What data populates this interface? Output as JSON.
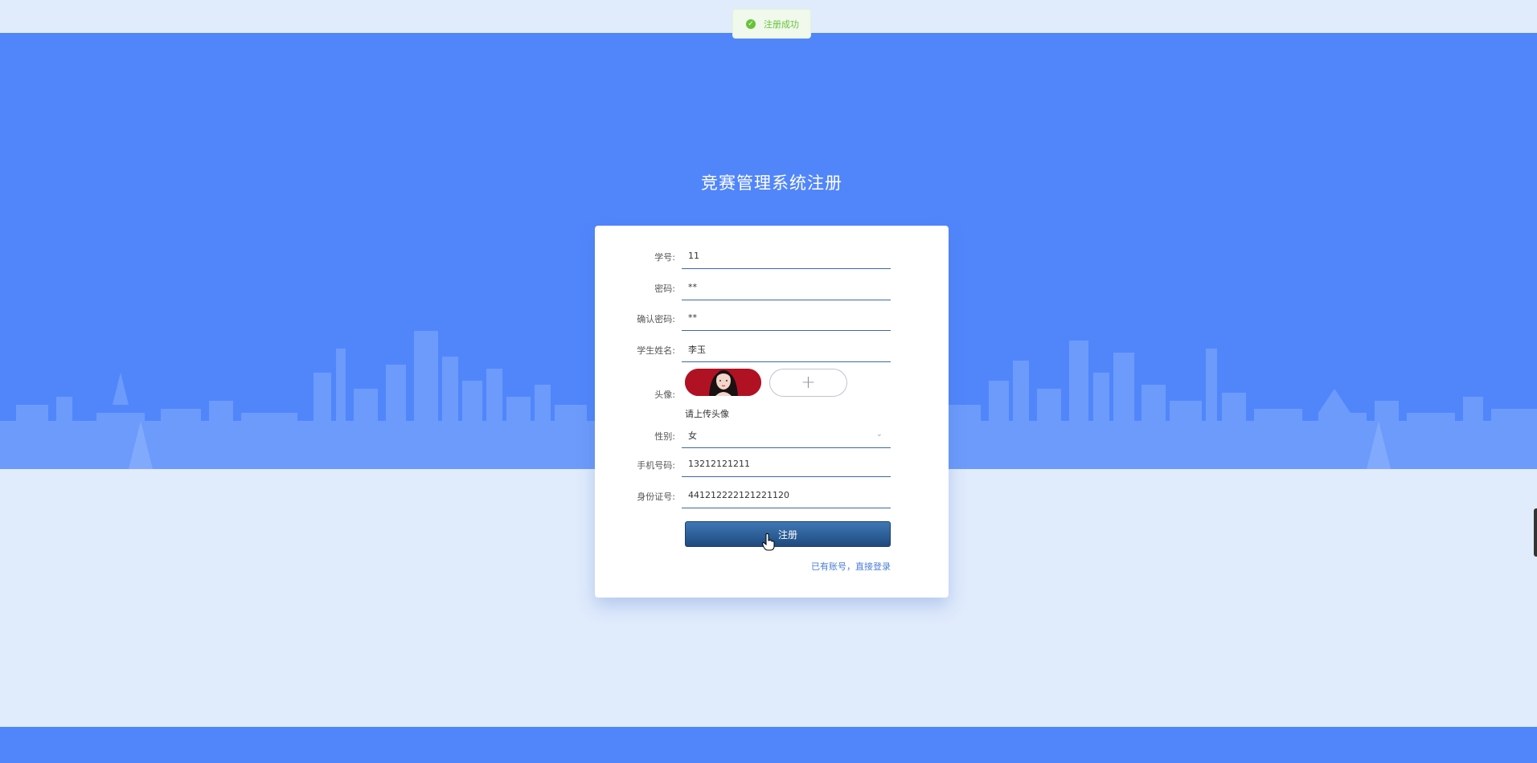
{
  "toast": {
    "icon": "check-circle-icon",
    "text": "注册成功",
    "color": "#67c23a"
  },
  "page": {
    "title": "竞赛管理系统注册"
  },
  "form": {
    "student_id": {
      "label": "学号:",
      "value": "11"
    },
    "password": {
      "label": "密码:",
      "value": "**"
    },
    "confirm_password": {
      "label": "确认密码:",
      "value": "**"
    },
    "student_name": {
      "label": "学生姓名:",
      "value": "李玉"
    },
    "avatar": {
      "label": "头像:",
      "upload_icon": "plus-icon",
      "tip": "请上传头像"
    },
    "gender": {
      "label": "性别:",
      "value": "女",
      "icon": "chevron-down-icon"
    },
    "phone": {
      "label": "手机号码:",
      "value": "13212121211"
    },
    "id_card": {
      "label": "身份证号:",
      "value": "441212222121221120"
    },
    "submit_label": "注册",
    "login_link": "已有账号，直接登录"
  },
  "colors": {
    "hero": "#5186fb",
    "background": "#e0ebfc",
    "button": "#2a5b92",
    "link": "#4a7dd8",
    "underline": "#3f68a8"
  }
}
